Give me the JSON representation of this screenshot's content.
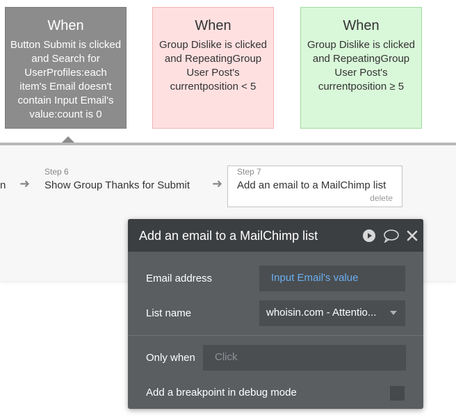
{
  "cards": [
    {
      "title": "When",
      "condition": "Button Submit is clicked and Search for UserProfiles:each item's Email doesn't contain Input Email's value:count is 0"
    },
    {
      "title": "When",
      "condition": "Group Dislike is clicked and RepeatingGroup User Post's currentposition < 5"
    },
    {
      "title": "When",
      "condition": "Group Dislike is clicked and RepeatingGroup User Post's currentposition ≥ 5"
    }
  ],
  "workflow": {
    "prev_step_tail": "n",
    "step6": {
      "number": "Step 6",
      "label": "Show Group Thanks for Submit"
    },
    "step7": {
      "number": "Step 7",
      "label": "Add an email to a MailChimp list",
      "delete": "delete"
    }
  },
  "dialog": {
    "title": "Add an email to a MailChimp list",
    "email_label": "Email address",
    "email_value": "Input Email's value",
    "list_label": "List name",
    "list_value": "whoisin.com - Attentio...",
    "only_when_label": "Only when",
    "only_when_placeholder": "Click",
    "breakpoint_label": "Add a breakpoint in debug mode"
  },
  "colors": {
    "link_blue": "#6aaef0",
    "dialog_bg": "#5a5e61",
    "header_bg": "#3c3f41"
  }
}
